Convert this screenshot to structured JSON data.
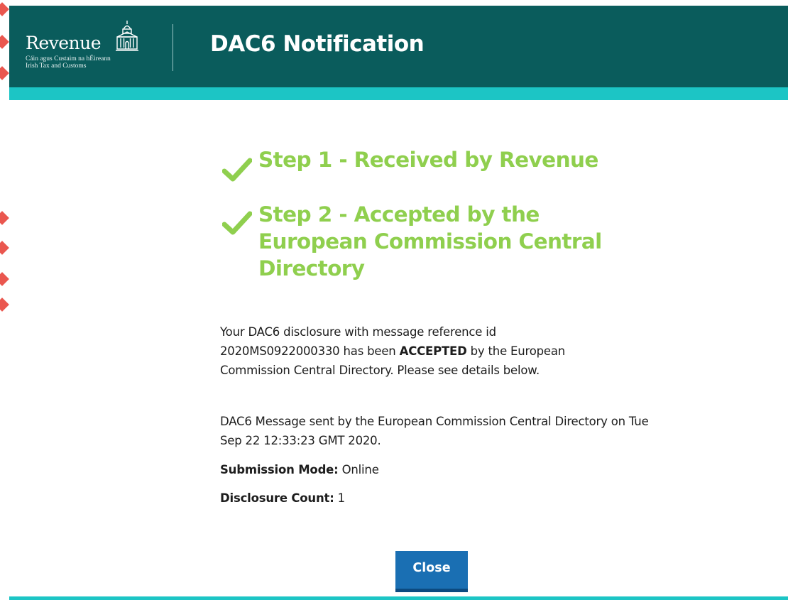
{
  "brand": {
    "name": "Revenue",
    "subtitle_irish": "Cáin agus Custaim na hÉireann",
    "subtitle_english": "Irish Tax and Customs",
    "header_color": "#0a5c5c",
    "accent_stripe_color": "#1cc5c5"
  },
  "header": {
    "title": "DAC6 Notification"
  },
  "steps": [
    {
      "icon": "checkmark-icon",
      "label": "Step 1 - Received by Revenue",
      "status": "complete",
      "color": "#8fcf4e"
    },
    {
      "icon": "checkmark-icon",
      "label": "Step 2 - Accepted by the European Commission Central Directory",
      "status": "complete",
      "color": "#8fcf4e"
    }
  ],
  "message": {
    "part1": "Your DAC6 disclosure with message reference id 2020MS0922000330 has been ",
    "status_word": "ACCEPTED",
    "part2": " by the European Commission Central Directory. Please see details below."
  },
  "sent_info": "DAC6 Message sent by the European Commission Central Directory on Tue Sep 22 12:33:23 GMT 2020.",
  "details": {
    "submission_mode_label": "Submission Mode:",
    "submission_mode_value": " Online",
    "disclosure_count_label": "Disclosure Count:",
    "disclosure_count_value": " 1"
  },
  "actions": {
    "close_label": "Close",
    "close_color": "#1a6fb3"
  }
}
